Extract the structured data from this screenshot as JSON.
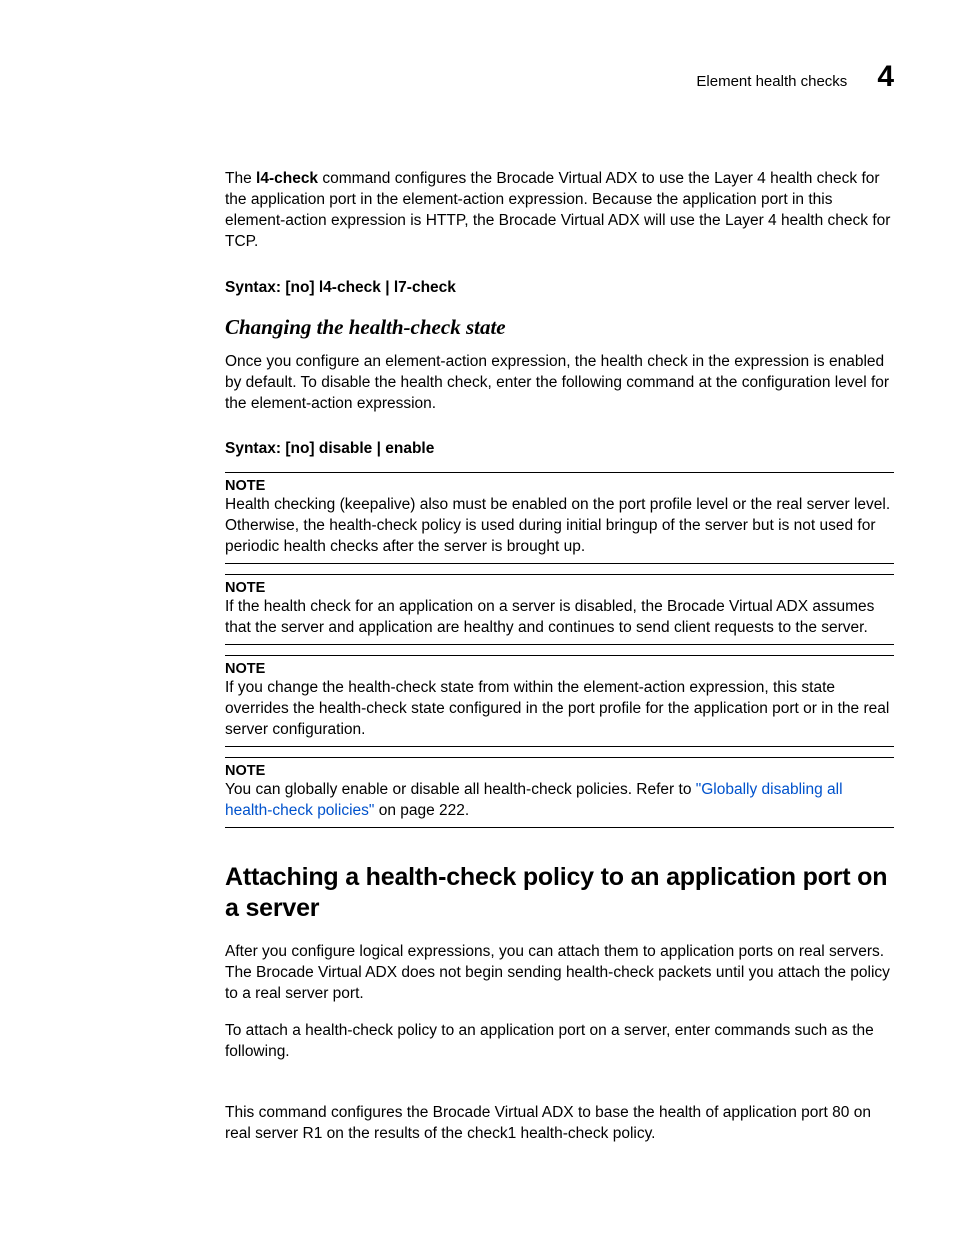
{
  "header": {
    "section": "Element health checks",
    "chapter": "4"
  },
  "p1": {
    "pre": "The ",
    "cmd": "l4-check",
    "post": " command configures the Brocade Virtual ADX to use the Layer 4 health check for the application port in the element-action expression. Because the application port in this element-action expression is HTTP, the Brocade Virtual ADX will use the Layer 4 health check for TCP."
  },
  "syntax1": {
    "label": "Syntax:  ",
    "body": "[no] l4-check | l7-check"
  },
  "h3_1": "Changing the health-check state",
  "p2": "Once you configure an element-action expression, the health check in the expression is enabled by default. To disable the health check, enter the following command at the configuration level for the element-action expression.",
  "syntax2": {
    "label": "Syntax:  ",
    "body": "[no] disable | enable"
  },
  "note1": {
    "label": "NOTE",
    "body": "Health checking (keepalive) also must be enabled on the port profile level or the real server level. Otherwise, the health-check policy is used during initial bringup of the server but is not used for periodic health checks after the server is brought up."
  },
  "note2": {
    "label": "NOTE",
    "body": "If the health check for an application on a server is disabled, the Brocade Virtual ADX assumes that the server and application are healthy and continues to send client requests to the server."
  },
  "note3": {
    "label": "NOTE",
    "body": "If you change the health-check state from within the element-action expression, this state overrides the health-check state configured in the port profile for the application port or in the real server configuration."
  },
  "note4": {
    "label": "NOTE",
    "pre": "You can globally enable or disable all health-check policies. Refer to ",
    "link": "\"Globally disabling all health-check policies\"",
    "post": " on page 222."
  },
  "h2_1": "Attaching a health-check policy to an application port on a server",
  "p3": "After you configure logical expressions, you can attach them to application ports on real servers. The Brocade Virtual ADX does not begin sending health-check packets until you attach the policy to a real server port.",
  "p4": "To attach a health-check policy to an application port on a server, enter commands such as the following.",
  "p5": "This command configures the Brocade Virtual ADX to base the health of application port 80 on real server R1 on the results of the check1 health-check policy."
}
